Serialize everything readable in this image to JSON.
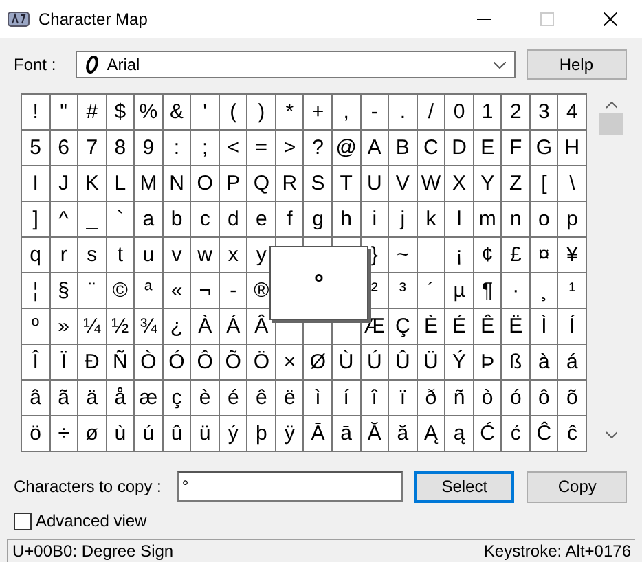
{
  "window": {
    "title": "Character Map"
  },
  "font": {
    "label": "Font :",
    "value": "Arial"
  },
  "help_button": "Help",
  "grid": {
    "rows": [
      [
        "!",
        "\"",
        "#",
        "$",
        "%",
        "&",
        "'",
        "(",
        ")",
        "*",
        "+",
        ",",
        "-",
        ".",
        "/",
        "0",
        "1",
        "2",
        "3",
        "4"
      ],
      [
        "5",
        "6",
        "7",
        "8",
        "9",
        ":",
        ";",
        "<",
        "=",
        ">",
        "?",
        "@",
        "A",
        "B",
        "C",
        "D",
        "E",
        "F",
        "G",
        "H"
      ],
      [
        "I",
        "J",
        "K",
        "L",
        "M",
        "N",
        "O",
        "P",
        "Q",
        "R",
        "S",
        "T",
        "U",
        "V",
        "W",
        "X",
        "Y",
        "Z",
        "[",
        "\\"
      ],
      [
        "]",
        "^",
        "_",
        "`",
        "a",
        "b",
        "c",
        "d",
        "e",
        "f",
        "g",
        "h",
        "i",
        "j",
        "k",
        "l",
        "m",
        "n",
        "o",
        "p"
      ],
      [
        "q",
        "r",
        "s",
        "t",
        "u",
        "v",
        "w",
        "x",
        "y",
        null,
        null,
        null,
        "}",
        "~",
        null,
        "¡",
        "¢",
        "£",
        "¤",
        "¥"
      ],
      [
        "¦",
        "§",
        "¨",
        "©",
        "ª",
        "«",
        "¬",
        "-",
        "®",
        null,
        null,
        null,
        "²",
        "³",
        "´",
        "µ",
        "¶",
        "·",
        "¸",
        "¹"
      ],
      [
        "º",
        "»",
        "¼",
        "½",
        "¾",
        "¿",
        "À",
        "Á",
        "Â",
        null,
        null,
        null,
        "Æ",
        "Ç",
        "È",
        "É",
        "Ê",
        "Ë",
        "Ì",
        "Í"
      ],
      [
        "Î",
        "Ï",
        "Ð",
        "Ñ",
        "Ò",
        "Ó",
        "Ô",
        "Õ",
        "Ö",
        "×",
        "Ø",
        "Ù",
        "Ú",
        "Û",
        "Ü",
        "Ý",
        "Þ",
        "ß",
        "à",
        "á"
      ],
      [
        "â",
        "ã",
        "ä",
        "å",
        "æ",
        "ç",
        "è",
        "é",
        "ê",
        "ë",
        "ì",
        "í",
        "î",
        "ï",
        "ð",
        "ñ",
        "ò",
        "ó",
        "ô",
        "õ"
      ],
      [
        "ö",
        "÷",
        "ø",
        "ù",
        "ú",
        "û",
        "ü",
        "ý",
        "þ",
        "ÿ",
        "Ā",
        "ā",
        "Ă",
        "ă",
        "Ą",
        "ą",
        "Ć",
        "ć",
        "Ĉ",
        "ĉ"
      ]
    ]
  },
  "magnified": {
    "char": "°"
  },
  "copy": {
    "label": "Characters to copy :",
    "value": "°"
  },
  "buttons": [
    {
      "label": "Select",
      "focused": true
    },
    {
      "label": "Copy",
      "focused": false
    }
  ],
  "advanced_view": {
    "label": "Advanced view",
    "checked": false
  },
  "status": {
    "left": "U+00B0: Degree Sign",
    "right": "Keystroke: Alt+0176"
  }
}
